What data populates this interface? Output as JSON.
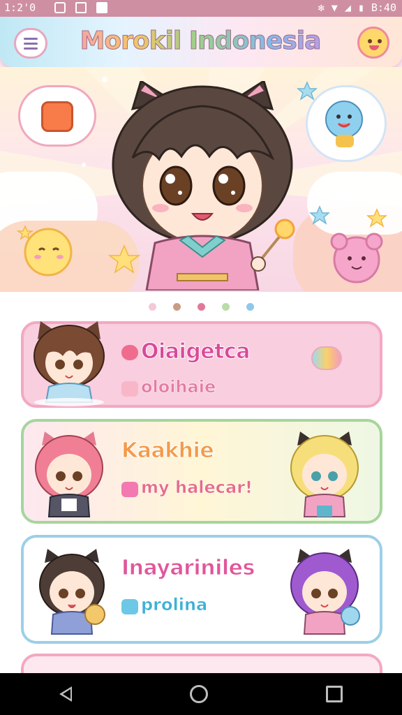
{
  "status_bar": {
    "time_left": "1:2'0",
    "time_right": "B:40",
    "icons": [
      "gallery-icon",
      "cast-icon",
      "notification-icon",
      "bluetooth-icon",
      "wifi-icon",
      "signal-icon",
      "battery-icon"
    ]
  },
  "header": {
    "title": "Morokil Indonesia",
    "menu_icon": "menu-icon",
    "profile_icon": "mascot-face-icon"
  },
  "carousel": {
    "dot_colors": [
      "#f3c9d6",
      "#c89c86",
      "#e07a98",
      "#b9dca8",
      "#8fc8ea"
    ],
    "active_index": 2
  },
  "cards": [
    {
      "title": "Oiaigetca",
      "subtitle": "oloihaie",
      "title_color": "#d9499a",
      "sub_color": "#e47ca1",
      "bg": "#f9cede",
      "border": "#f3a8c2",
      "fav_icon": "heart-bubble-icon"
    },
    {
      "title": "Kaakhie",
      "subtitle": "my halecar!",
      "title_color": "#f39a4b",
      "sub_color": "#e66b8b",
      "bg": "#fff6d6",
      "border": "#a6d59c"
    },
    {
      "title": "Inayariniles",
      "subtitle": "prolina",
      "title_color": "#e0569b",
      "sub_color": "#3fb0d6",
      "bg": "#ffffff",
      "border": "#9ccfe8"
    }
  ],
  "nav": {
    "back": "back-icon",
    "home": "home-icon",
    "recent": "recent-apps-icon"
  }
}
